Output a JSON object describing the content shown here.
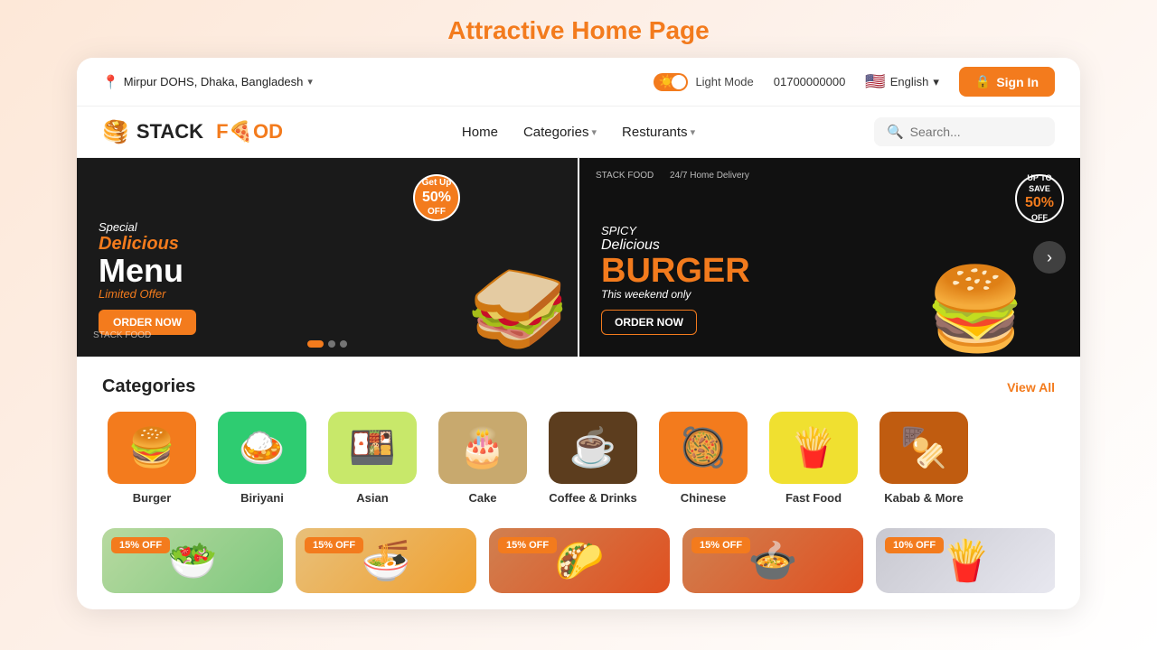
{
  "page": {
    "title": "Attractive Home Page"
  },
  "topbar": {
    "location": "Mirpur DOHS, Dhaka, Bangladesh",
    "mode_label": "Light Mode",
    "phone": "01700000000",
    "language": "English",
    "signin_label": "Sign In"
  },
  "navbar": {
    "logo_text_1": "STACK",
    "logo_text_2": "F",
    "logo_text_3": "OD",
    "nav_home": "Home",
    "nav_categories": "Categories",
    "nav_restaurants": "Resturants",
    "search_placeholder": "Search..."
  },
  "banner_left": {
    "special": "Special",
    "delicious": "Delicious",
    "menu": "Menu",
    "limited": "Limited Offer",
    "badge_line1": "Get Up",
    "badge_line2": "50%",
    "badge_line3": "OFF",
    "order_btn": "ORDER NOW",
    "brand": "STACK FOOD"
  },
  "banner_right": {
    "spicy": "SPICY",
    "delicious": "Delicious",
    "burger": "BURGER",
    "weekend": "This weekend only",
    "save_line1": "UP TO",
    "save_line2": "SAVE",
    "save_line3": "50%",
    "save_line4": "OFF",
    "delivery": "24/7 Home Delivery",
    "order_btn": "ORDER NOW",
    "brand": "STACK FOOD"
  },
  "categories": {
    "title": "Categories",
    "view_all": "View All",
    "items": [
      {
        "label": "Burger",
        "icon": "🍔",
        "bg": "cat-orange"
      },
      {
        "label": "Biriyani",
        "icon": "🍛",
        "bg": "cat-green"
      },
      {
        "label": "Asian",
        "icon": "🍱",
        "bg": "cat-lime"
      },
      {
        "label": "Cake",
        "icon": "🎂",
        "bg": "cat-tan"
      },
      {
        "label": "Coffee & Drinks",
        "icon": "☕",
        "bg": "cat-brown"
      },
      {
        "label": "Chinese",
        "icon": "🥘",
        "bg": "cat-orange2"
      },
      {
        "label": "Fast Food",
        "icon": "🍟",
        "bg": "cat-yellow"
      },
      {
        "label": "Kabab & More",
        "icon": "🍢",
        "bg": "cat-darkorange"
      }
    ]
  },
  "food_cards": {
    "items": [
      {
        "badge": "15% OFF",
        "bg": "fc1",
        "icon": "🥗"
      },
      {
        "badge": "15% OFF",
        "bg": "fc2",
        "icon": "🍜"
      },
      {
        "badge": "15% OFF",
        "bg": "fc3",
        "icon": "🌮"
      },
      {
        "badge": "15% OFF",
        "bg": "fc3",
        "icon": "🍲"
      },
      {
        "badge": "10% OFF",
        "bg": "fc5",
        "icon": "🍟"
      }
    ]
  }
}
